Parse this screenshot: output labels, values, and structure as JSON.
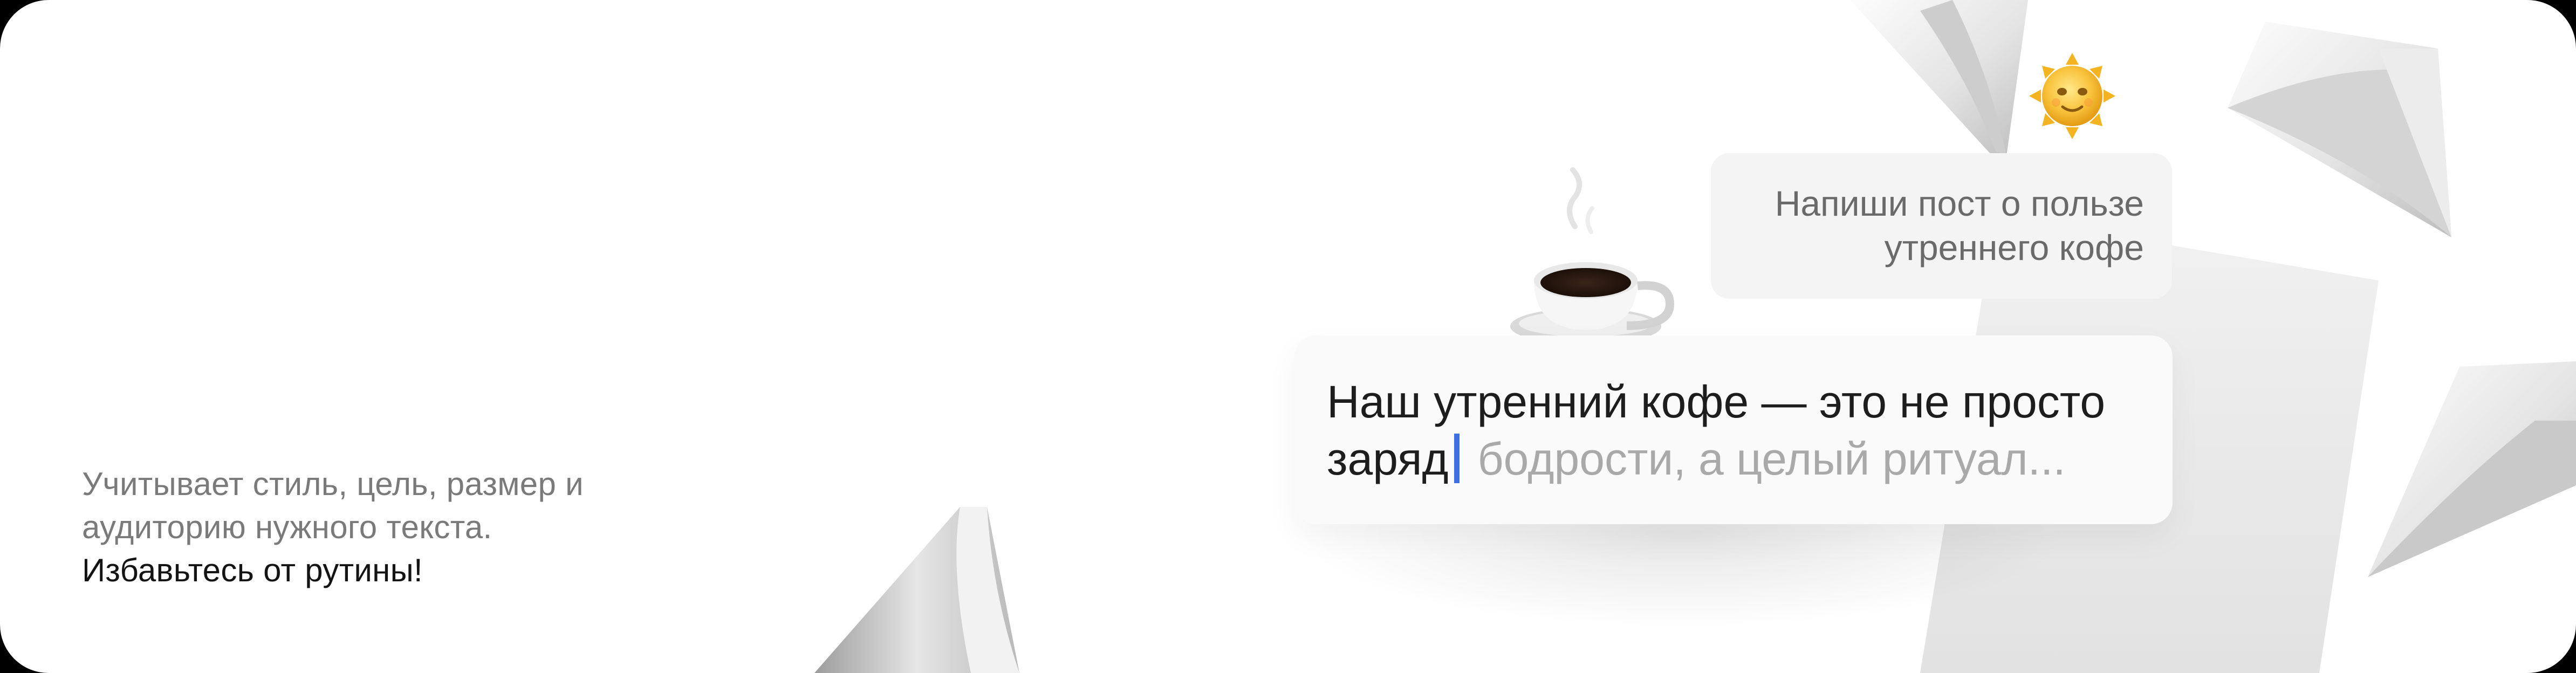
{
  "tagline": {
    "line1": "Учитывает стиль, цель, размер и",
    "line2": "аудиторию нужного текста.",
    "line3": "Избавьтесь от рутины!"
  },
  "chat": {
    "prompt_line1": "Напиши пост о пользе",
    "prompt_line2": "утреннего кофе",
    "reply_line1": "Наш утренний кофе — это не просто",
    "reply_typed": "заряд",
    "reply_suggestion": "бодрости, а целый ритуал..."
  },
  "icons": [
    "sun-emoji-icon",
    "coffee-cup-emoji-icon",
    "paper-sheet-icon"
  ],
  "colors": {
    "background": "#ffffff",
    "frame": "#000000",
    "caret": "#3d6fe0",
    "suggestion_text": "#a9a9a9",
    "prompt_bubble": "#f4f4f4"
  }
}
